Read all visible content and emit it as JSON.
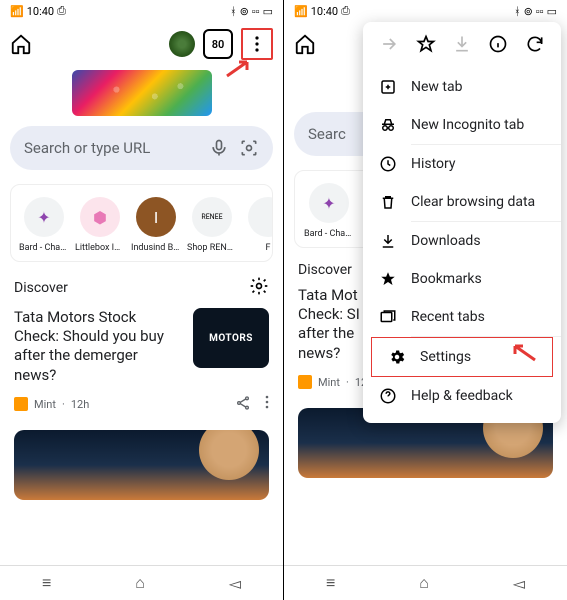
{
  "status": {
    "time": "10:40",
    "signal_icon": "5G",
    "camera_icon": "⎙",
    "bluetooth": "✱",
    "wifi": "⊕",
    "battery": "75"
  },
  "topbar": {
    "tab_count": "80"
  },
  "search": {
    "placeholder": "Search or type URL"
  },
  "shortcuts": [
    {
      "label": "Bard - Chat ...",
      "glyph": "✦",
      "color": "#8e44ad"
    },
    {
      "label": "Littlebox In...",
      "glyph": "🛍",
      "color": "#e879b6"
    },
    {
      "label": "Indusind Ba...",
      "glyph": "I",
      "color": "#8d5524"
    },
    {
      "label": "Shop RENE...",
      "glyph": "RENEE",
      "color": "#555"
    },
    {
      "label": "F",
      "glyph": "",
      "color": "#999"
    }
  ],
  "discover": {
    "label": "Discover"
  },
  "card": {
    "title": "Tata Motors Stock Check: Should you buy after the demerger news?",
    "title_short": "Tata Mot\nCheck: SI\nafter the\nnews?",
    "img_text": "MOTORS",
    "source": "Mint",
    "time": "12h"
  },
  "menu": {
    "new_tab": "New tab",
    "incognito": "New Incognito tab",
    "history": "History",
    "clear": "Clear browsing data",
    "downloads": "Downloads",
    "bookmarks": "Bookmarks",
    "recent": "Recent tabs",
    "settings": "Settings",
    "help": "Help & feedback"
  }
}
